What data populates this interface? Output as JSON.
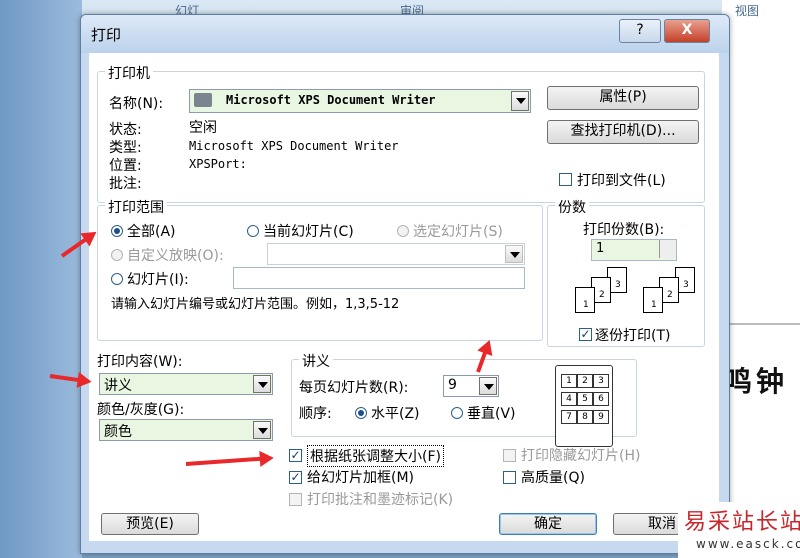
{
  "background": {
    "tabs": [
      "幻灯",
      "审阅",
      "视图"
    ],
    "slide_text": "鸣钟"
  },
  "window": {
    "title": "打印",
    "help_label": "?",
    "close_label": "X"
  },
  "printer": {
    "group_title": "打印机",
    "name_label": "名称(N):",
    "name_value": "Microsoft XPS Document Writer",
    "status_label": "状态:",
    "status_value": "空闲",
    "type_label": "类型:",
    "type_value": "Microsoft XPS Document Writer",
    "location_label": "位置:",
    "location_value": "XPSPort:",
    "comment_label": "批注:",
    "properties_button": "属性(P)",
    "find_button": "查找打印机(D)...",
    "print_to_file": "打印到文件(L)"
  },
  "range": {
    "group_title": "打印范围",
    "all": "全部(A)",
    "current": "当前幻灯片(C)",
    "selection": "选定幻灯片(S)",
    "custom_show": "自定义放映(O):",
    "slides": "幻灯片(I):",
    "hint": "请输入幻灯片编号或幻灯片范围。例如，1,3,5-12"
  },
  "copies": {
    "group_title": "份数",
    "count_label": "打印份数(B):",
    "count_value": "1",
    "collate": "逐份打印(T)",
    "page_numbers": [
      "1",
      "2",
      "3"
    ]
  },
  "content": {
    "print_what_label": "打印内容(W):",
    "print_what_value": "讲义",
    "color_label": "颜色/灰度(G):",
    "color_value": "颜色"
  },
  "handouts": {
    "group_title": "讲义",
    "per_page_label": "每页幻灯片数(R):",
    "per_page_value": "9",
    "order_label": "顺序:",
    "horizontal": "水平(Z)",
    "vertical": "垂直(V)",
    "preview_numbers": [
      "1",
      "2",
      "3",
      "4",
      "5",
      "6",
      "7",
      "8",
      "9"
    ]
  },
  "options": {
    "scale_to_fit": "根据纸张调整大小(F)",
    "frame_slides": "给幻灯片加框(M)",
    "print_comments": "打印批注和墨迹标记(K)",
    "print_hidden": "打印隐藏幻灯片(H)",
    "high_quality": "高质量(Q)"
  },
  "footer": {
    "preview_button": "预览(E)",
    "ok_button": "确定",
    "cancel_button": "取消"
  },
  "watermark": {
    "brand": "易采站长站",
    "url": "www.easck.com"
  },
  "colors": {
    "combo_bg": "#e8f6e2",
    "arrow": "#e8282b",
    "dialog_frame": "#c6d9ef"
  }
}
